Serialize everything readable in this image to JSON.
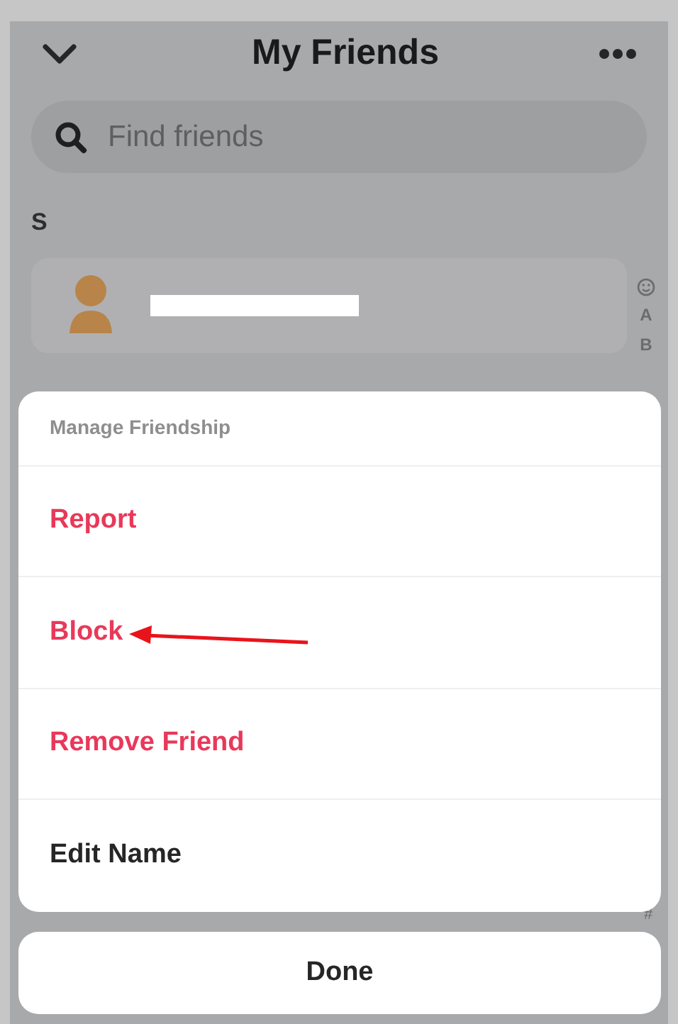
{
  "header": {
    "title": "My Friends"
  },
  "search": {
    "placeholder": "Find friends"
  },
  "section": {
    "letter": "S"
  },
  "index_letters": [
    "A",
    "B",
    "#"
  ],
  "sheet": {
    "title": "Manage Friendship",
    "actions": [
      {
        "label": "Report",
        "kind": "destructive"
      },
      {
        "label": "Block",
        "kind": "destructive"
      },
      {
        "label": "Remove Friend",
        "kind": "destructive"
      },
      {
        "label": "Edit Name",
        "kind": "normal"
      }
    ]
  },
  "done_button": {
    "label": "Done"
  }
}
